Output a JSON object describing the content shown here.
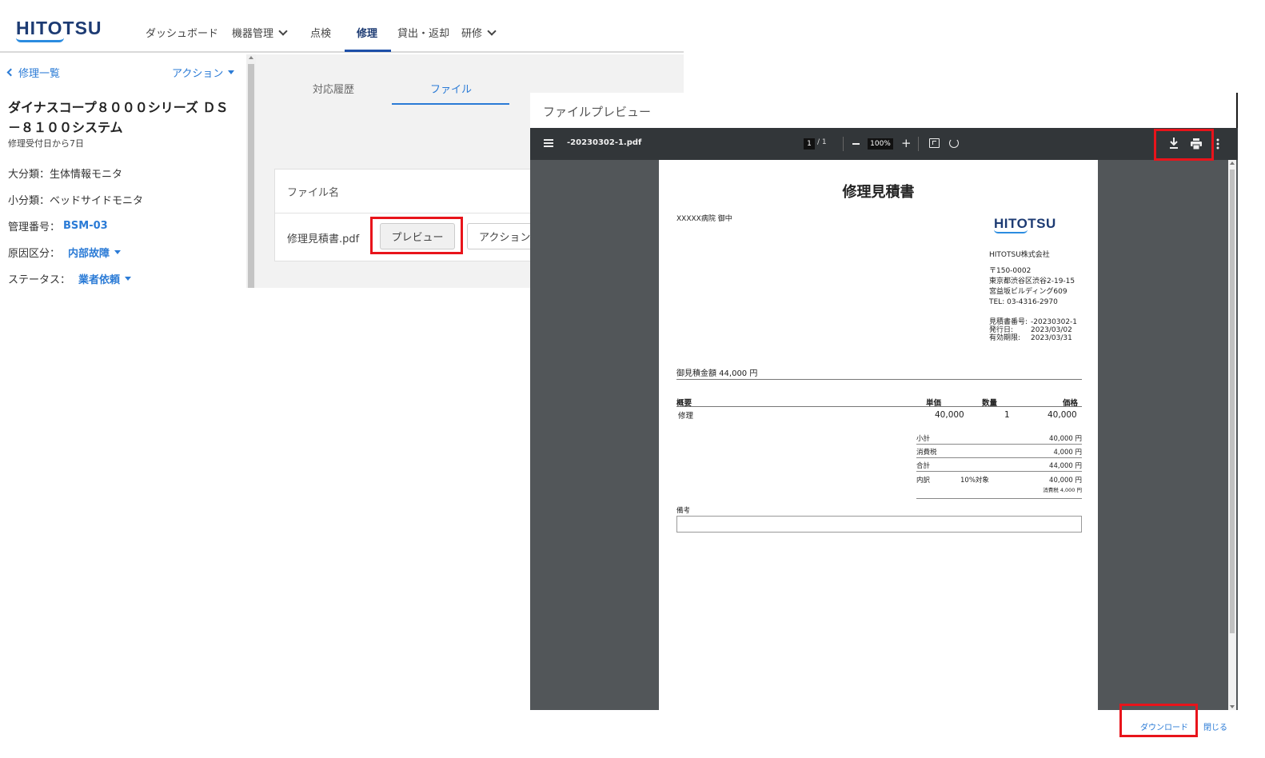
{
  "header": {
    "logo": "HITOTSU",
    "nav": [
      {
        "label": "ダッシュボード"
      },
      {
        "label": "機器管理"
      },
      {
        "label": "点検"
      },
      {
        "label": "修理"
      },
      {
        "label": "貸出・返却"
      },
      {
        "label": "研修"
      }
    ]
  },
  "sidebar": {
    "back_label": "修理一覧",
    "action_label": "アクション",
    "device_title": "ダイナスコープ８０００シリーズ ＤＳ－８１００システム",
    "since_label": "修理受付日から7日",
    "major_class": "大分類：生体情報モニタ",
    "minor_class": "小分類：ベッドサイドモニタ",
    "mgmt_label": "管理番号：",
    "mgmt_value": "BSM-03",
    "cause_label": "原因区分：",
    "cause_value": "内部故障",
    "status_label": "ステータス：",
    "status_value": "業者依頼"
  },
  "content": {
    "tabs": [
      {
        "label": "対応履歴"
      },
      {
        "label": "ファイル"
      }
    ],
    "file_header": "ファイル名",
    "file_name": "修理見積書.pdf",
    "preview_button": "プレビュー",
    "action_button": "アクション"
  },
  "dialog": {
    "title": "ファイルプレビュー",
    "pdf_toolbar": {
      "filename": "-20230302-1.pdf",
      "page_current": "1",
      "page_total": "/ 1",
      "zoom": "100%"
    },
    "document": {
      "title": "修理見積書",
      "recipient": "XXXXX病院 御中",
      "logo": "HITOTSU",
      "company": "HITOTSU株式会社",
      "address_lines": [
        "〒150-0002",
        "東京都渋谷区渋谷2-19-15",
        "宮益坂ビルディング609",
        "TEL: 03-4316-2970"
      ],
      "meta": [
        {
          "k": "見積書番号:",
          "v": "-20230302-1"
        },
        {
          "k": "発行日:",
          "v": "2023/03/02"
        },
        {
          "k": "有効期限:",
          "v": "2023/03/31"
        }
      ],
      "total_line": "御見積金額 44,000 円",
      "table_headers": {
        "summary": "概要",
        "unit_price": "単価",
        "qty": "数量",
        "price": "価格"
      },
      "item": {
        "summary": "修理",
        "unit_price": "40,000",
        "qty": "1",
        "price": "40,000"
      },
      "subtotal": {
        "k": "小計",
        "v": "40,000 円"
      },
      "tax": {
        "k": "消費税",
        "v": "4,000 円"
      },
      "grand": {
        "k": "合計",
        "v": "44,000 円"
      },
      "breakdown": {
        "k": "内訳",
        "rate": "10%対象",
        "v": "40,000 円",
        "tax_note": "消費税 4,000 円"
      },
      "remarks_label": "備考"
    },
    "footer": {
      "download": "ダウンロード",
      "close": "閉じる"
    }
  },
  "colors": {
    "accent": "#2b7bd6",
    "brand": "#1d3b73",
    "highlight": "#e8141b",
    "pdf_toolbar": "#323639"
  }
}
